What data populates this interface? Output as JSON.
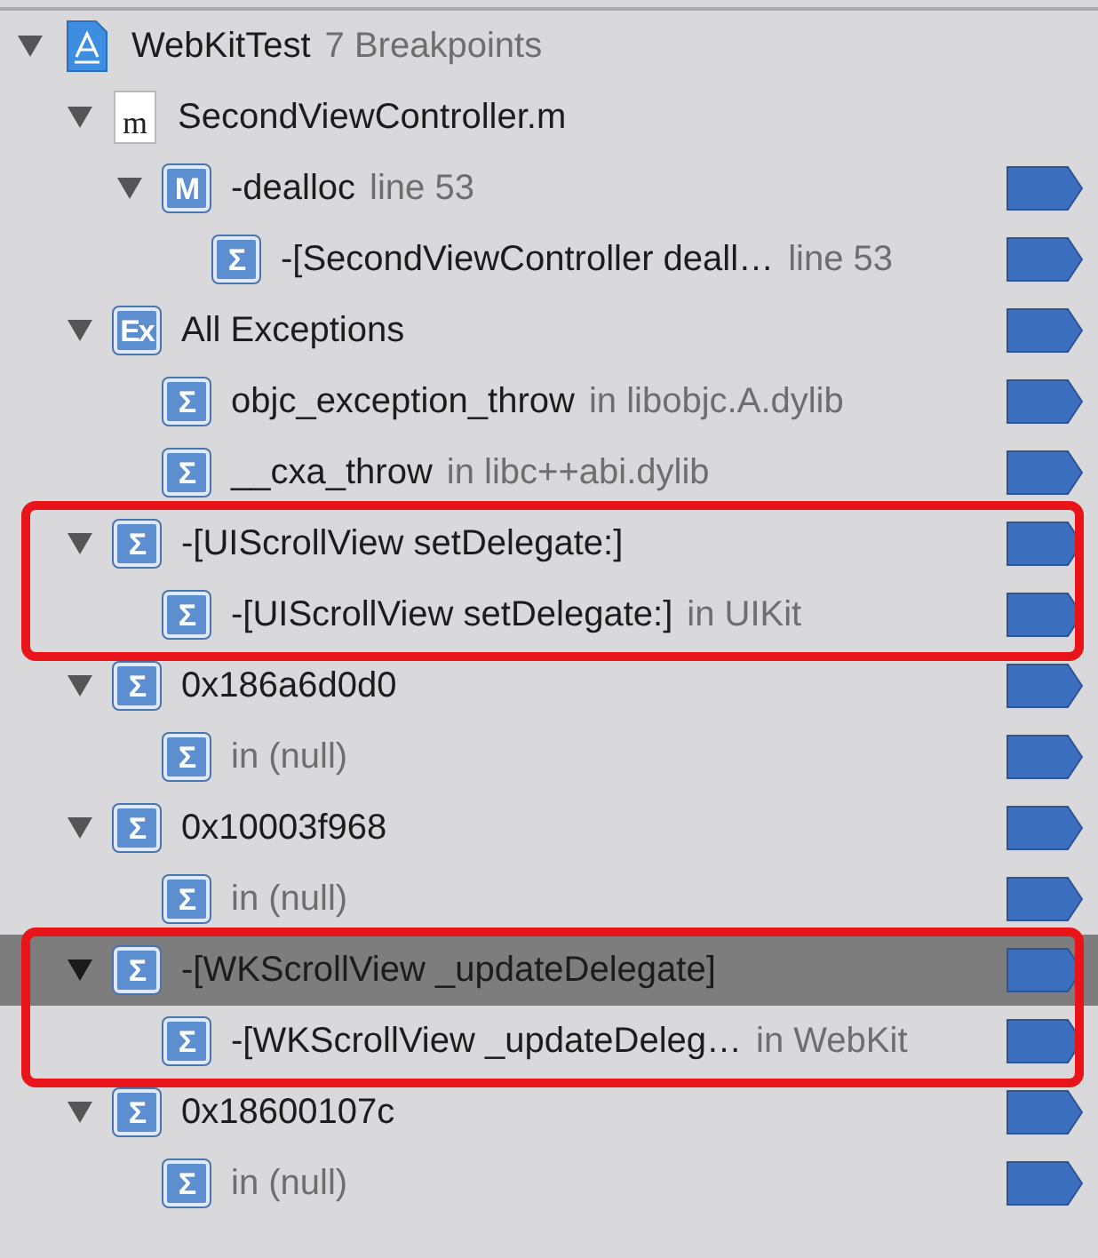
{
  "breakpoint_navigator": {
    "tree": [
      {
        "kind": "project",
        "title": "WebKitTest",
        "detail": "7 Breakpoints",
        "expanded": true,
        "selected": false,
        "breakpoint": false,
        "circled": false,
        "children": [
          {
            "kind": "file",
            "badge": "m",
            "title": "SecondViewController.m",
            "expanded": true,
            "selected": false,
            "breakpoint": false,
            "circled": false,
            "children": [
              {
                "kind": "badge",
                "badge": "M",
                "title": "-dealloc",
                "detail": "line 53",
                "expanded": true,
                "selected": false,
                "breakpoint": true,
                "circled": false,
                "children": [
                  {
                    "kind": "badge",
                    "badge": "Σ",
                    "title": "-[SecondViewController deall…",
                    "detail": "line 53",
                    "selected": false,
                    "breakpoint": true,
                    "circled": false
                  }
                ]
              }
            ]
          },
          {
            "kind": "badge",
            "badge": "Ex",
            "title": "All Exceptions",
            "expanded": true,
            "selected": false,
            "breakpoint": true,
            "circled": false,
            "children": [
              {
                "kind": "badge",
                "badge": "Σ",
                "title": "objc_exception_throw",
                "detail": "in libobjc.A.dylib",
                "selected": false,
                "breakpoint": true,
                "circled": false
              },
              {
                "kind": "badge",
                "badge": "Σ",
                "title": "__cxa_throw",
                "detail": "in libc++abi.dylib",
                "selected": false,
                "breakpoint": true,
                "circled": false
              }
            ]
          },
          {
            "kind": "badge",
            "badge": "Σ",
            "title": "-[UIScrollView setDelegate:]",
            "expanded": true,
            "selected": false,
            "breakpoint": true,
            "circled": true,
            "children": [
              {
                "kind": "badge",
                "badge": "Σ",
                "title": "-[UIScrollView setDelegate:]",
                "detail": "in UIKit",
                "selected": false,
                "breakpoint": true,
                "circled": false
              }
            ]
          },
          {
            "kind": "badge",
            "badge": "Σ",
            "title": "0x186a6d0d0",
            "expanded": true,
            "selected": false,
            "breakpoint": true,
            "circled": false,
            "children": [
              {
                "kind": "badge",
                "badge": "Σ",
                "detail": "in (null)",
                "selected": false,
                "breakpoint": true,
                "circled": false
              }
            ]
          },
          {
            "kind": "badge",
            "badge": "Σ",
            "title": "0x10003f968",
            "expanded": true,
            "selected": false,
            "breakpoint": true,
            "circled": false,
            "children": [
              {
                "kind": "badge",
                "badge": "Σ",
                "detail": "in (null)",
                "selected": false,
                "breakpoint": true,
                "circled": false
              }
            ]
          },
          {
            "kind": "badge",
            "badge": "Σ",
            "title": "-[WKScrollView _updateDelegate]",
            "expanded": true,
            "selected": true,
            "breakpoint": true,
            "circled": true,
            "children": [
              {
                "kind": "badge",
                "badge": "Σ",
                "title": "-[WKScrollView _updateDeleg…",
                "detail": "in WebKit",
                "selected": false,
                "breakpoint": true,
                "circled": false
              }
            ]
          },
          {
            "kind": "badge",
            "badge": "Σ",
            "title": "0x18600107c",
            "expanded": true,
            "selected": false,
            "breakpoint": true,
            "circled": false,
            "children": [
              {
                "kind": "badge",
                "badge": "Σ",
                "detail": "in (null)",
                "selected": false,
                "breakpoint": true,
                "circled": false
              }
            ]
          }
        ]
      }
    ]
  }
}
